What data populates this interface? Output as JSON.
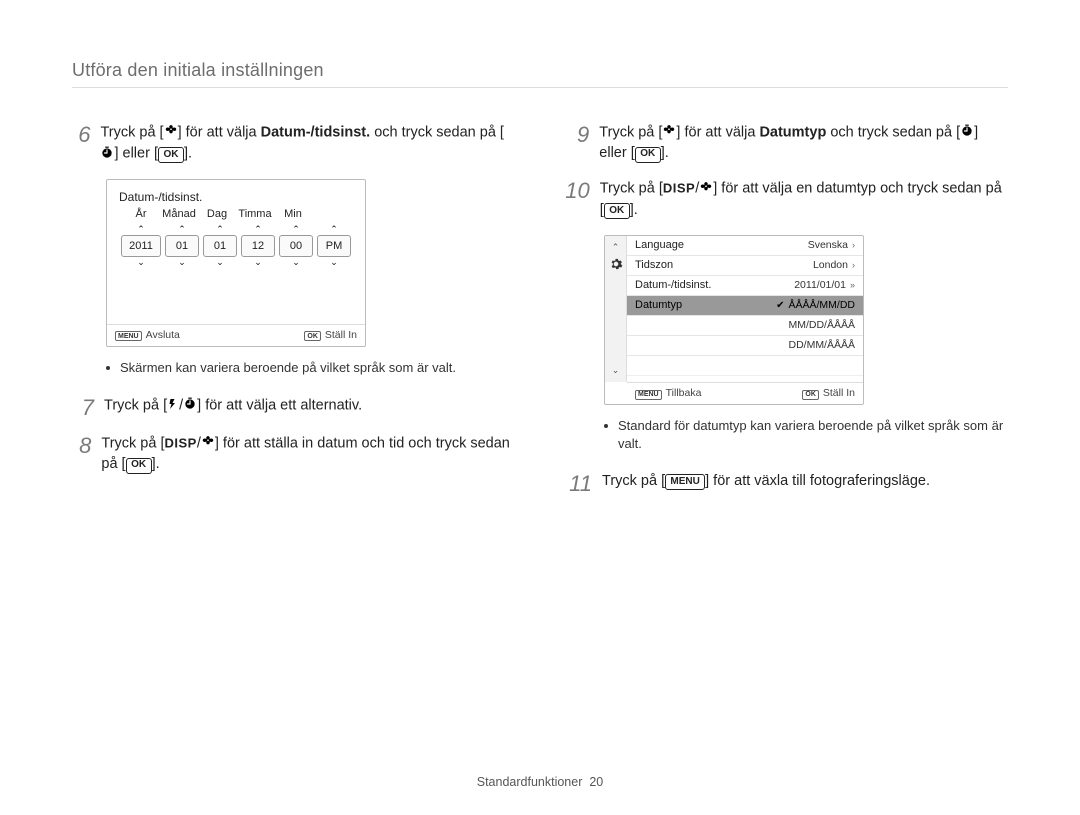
{
  "pageTitle": "Utföra den initiala inställningen",
  "footer": {
    "label": "Standardfunktioner",
    "page": "20"
  },
  "buttons": {
    "ok": "OK",
    "menu": "MENU",
    "disp": "DISP"
  },
  "steps": {
    "s6": {
      "pre": "Tryck på [",
      "mid": "] för att välja ",
      "bold": "Datum-/tidsinst.",
      "after": " och tryck sedan på [",
      "or": "] eller [",
      "end": "]."
    },
    "s7": {
      "pre": "Tryck på [",
      "end": "] för att välja ett alternativ."
    },
    "s8": {
      "pre": "Tryck på [",
      "mid": "] för att ställa in datum och tid och tryck sedan på [",
      "end": "]."
    },
    "s9": {
      "pre": "Tryck på [",
      "mid": "] för att välja ",
      "bold": "Datumtyp",
      "after": " och tryck sedan på [",
      "or": "] eller [",
      "end": "]."
    },
    "s10": {
      "pre": "Tryck på [",
      "mid": "] för att välja en datumtyp och tryck sedan på  [",
      "end": "]."
    },
    "s11": {
      "pre": "Tryck på [",
      "end": "] för att växla till fotograferingsläge."
    }
  },
  "notes": {
    "n1": "Skärmen kan variera beroende på vilket språk som är valt.",
    "n2": "Standard för datumtyp kan variera beroende på vilket språk som är valt."
  },
  "screen1": {
    "title": "Datum-/tidsinst.",
    "labels": [
      "År",
      "Månad",
      "Dag",
      "Timma",
      "Min",
      ""
    ],
    "values": [
      "2011",
      "01",
      "01",
      "12",
      "00",
      "PM"
    ],
    "footLeftBtn": "MENU",
    "footLeft": "Avsluta",
    "footRightBtn": "OK",
    "footRight": "Ställ In"
  },
  "screen2": {
    "rows": [
      {
        "label": "Language",
        "value": "Svenska",
        "chev": "›"
      },
      {
        "label": "Tidszon",
        "value": "London",
        "chev": "›"
      },
      {
        "label": "Datum-/tidsinst.",
        "value": "2011/01/01",
        "chev": "»"
      },
      {
        "label": "Datumtyp",
        "value": "ÅÅÅÅ/MM/DD",
        "chev": "",
        "selected": true,
        "check": true
      },
      {
        "label": "",
        "value": "MM/DD/ÅÅÅÅ",
        "chev": ""
      },
      {
        "label": "",
        "value": "DD/MM/ÅÅÅÅ",
        "chev": ""
      }
    ],
    "footLeftBtn": "MENU",
    "footLeft": "Tillbaka",
    "footRightBtn": "OK",
    "footRight": "Ställ In"
  }
}
